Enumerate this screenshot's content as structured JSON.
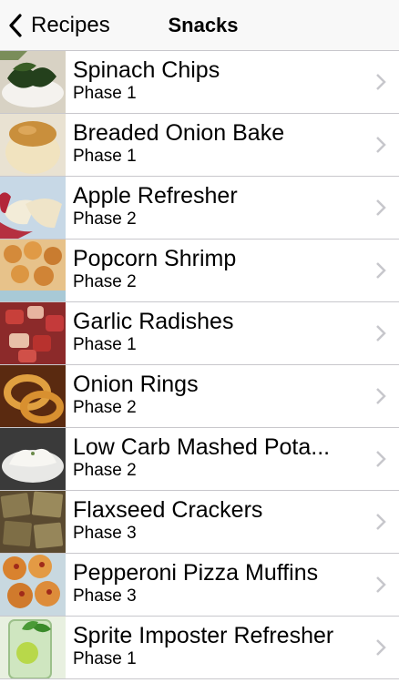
{
  "nav": {
    "back_label": "Recipes",
    "title": "Snacks"
  },
  "recipes": [
    {
      "title": "Spinach Chips",
      "phase": "Phase 1",
      "icon": "spinach-chips-photo"
    },
    {
      "title": "Breaded Onion Bake",
      "phase": "Phase 1",
      "icon": "onion-bake-photo"
    },
    {
      "title": "Apple Refresher",
      "phase": "Phase 2",
      "icon": "apple-photo"
    },
    {
      "title": "Popcorn Shrimp",
      "phase": "Phase 2",
      "icon": "shrimp-photo"
    },
    {
      "title": "Garlic Radishes",
      "phase": "Phase 1",
      "icon": "radishes-photo"
    },
    {
      "title": "Onion Rings",
      "phase": "Phase 2",
      "icon": "onion-rings-photo"
    },
    {
      "title": "Low Carb Mashed Pota...",
      "phase": "Phase 2",
      "icon": "mashed-photo"
    },
    {
      "title": "Flaxseed Crackers",
      "phase": "Phase 3",
      "icon": "crackers-photo"
    },
    {
      "title": "Pepperoni Pizza Muffins",
      "phase": "Phase 3",
      "icon": "muffins-photo"
    },
    {
      "title": "Sprite Imposter Refresher",
      "phase": "Phase 1",
      "icon": "drink-photo"
    }
  ]
}
